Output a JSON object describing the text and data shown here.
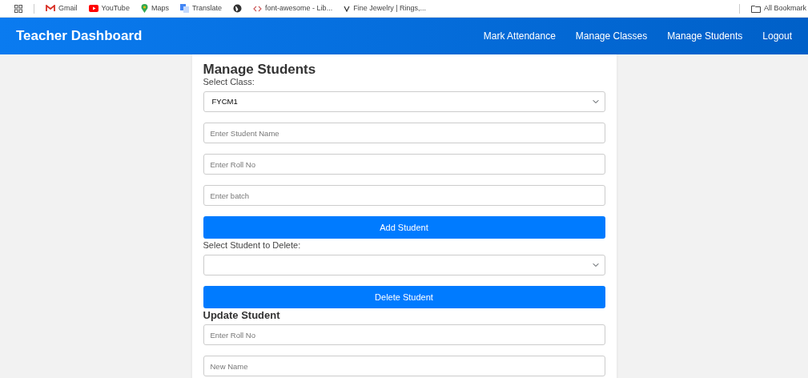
{
  "bookmarks_bar": {
    "items": [
      {
        "kind": "mail",
        "label": "Gmail"
      },
      {
        "kind": "video",
        "label": "YouTube"
      },
      {
        "kind": "pin",
        "label": "Maps"
      },
      {
        "kind": "translate",
        "label": "Translate"
      },
      {
        "kind": "globe"
      },
      {
        "kind": "code",
        "label": "font-awesome - Lib..."
      },
      {
        "kind": "letter",
        "label": "Fine Jewelry | Rings,..."
      }
    ],
    "all_bookmarks": "All Bookmark"
  },
  "navbar": {
    "brand": "Teacher Dashboard",
    "links": [
      {
        "label": "Mark Attendance"
      },
      {
        "label": "Manage Classes"
      },
      {
        "label": "Manage Students"
      },
      {
        "label": "Logout"
      }
    ]
  },
  "form": {
    "title": "Manage Students",
    "fields": [
      {
        "kind": "label",
        "text": "Select Class:"
      },
      {
        "kind": "select",
        "value": "FYCM1"
      },
      {
        "kind": "input",
        "placeholder": "Enter Student Name"
      },
      {
        "kind": "input",
        "placeholder": "Enter Roll No"
      },
      {
        "kind": "input",
        "placeholder": "Enter batch"
      },
      {
        "kind": "button",
        "text": "Add Student"
      },
      {
        "kind": "label",
        "text": "Select Student to Delete:"
      },
      {
        "kind": "select"
      },
      {
        "kind": "button",
        "text": "Delete Student"
      },
      {
        "kind": "heading",
        "text": "Update Student"
      },
      {
        "kind": "input",
        "placeholder": "Enter Roll No"
      },
      {
        "kind": "input",
        "placeholder": "New Name"
      }
    ]
  }
}
